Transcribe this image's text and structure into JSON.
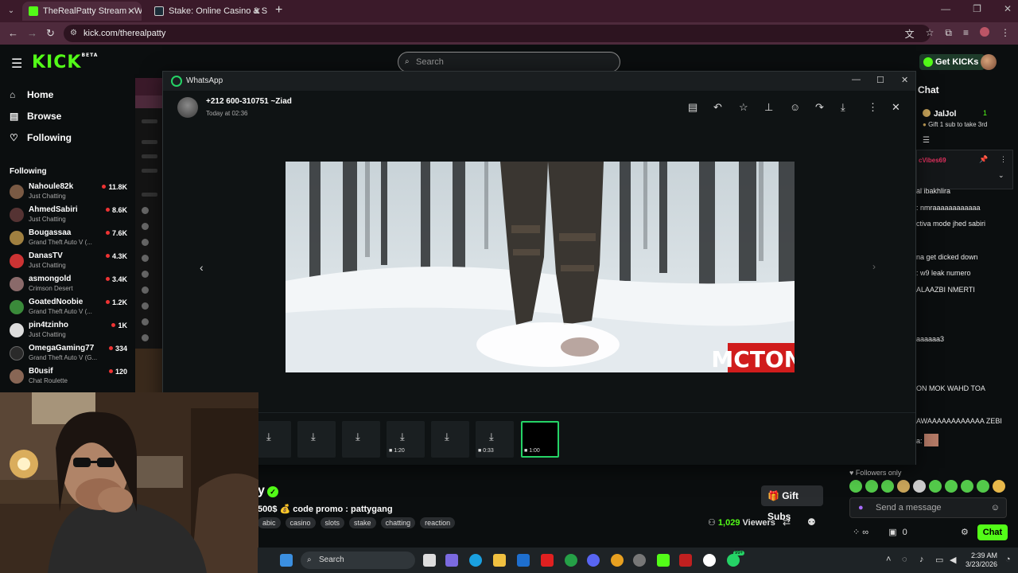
{
  "browser": {
    "tabs": [
      {
        "title": "TheRealPatty Stream - Watch Li",
        "favicon_color": "#53fc18"
      },
      {
        "title": "Stake: Online Casino & Sports B",
        "favicon_color": "#1a2c38"
      }
    ],
    "url": "kick.com/therealpatty"
  },
  "kick": {
    "logo": "KICK",
    "logo_badge": "BETA",
    "search_placeholder": "Search",
    "get_kicks": "Get KICKs",
    "nav": [
      "Home",
      "Browse",
      "Following"
    ],
    "following_heading": "Following",
    "following": [
      {
        "name": "Nahoule82k",
        "category": "Just Chatting",
        "viewers": "11.8K"
      },
      {
        "name": "AhmedSabiri",
        "category": "Just Chatting",
        "viewers": "8.6K"
      },
      {
        "name": "Bougassaa",
        "category": "Grand Theft Auto V (...",
        "viewers": "7.6K"
      },
      {
        "name": "DanasTV",
        "category": "Just Chatting",
        "viewers": "4.3K"
      },
      {
        "name": "asmongold",
        "category": "Crimson Desert",
        "viewers": "3.4K"
      },
      {
        "name": "GoatedNoobie",
        "category": "Grand Theft Auto V (...",
        "viewers": "1.2K"
      },
      {
        "name": "pin4tzinho",
        "category": "Just Chatting",
        "viewers": "1K"
      },
      {
        "name": "OmegaGaming77",
        "category": "Grand Theft Auto V (G...",
        "viewers": "334"
      },
      {
        "name": "B0usif",
        "category": "Chat Roulette",
        "viewers": "120"
      }
    ],
    "stream": {
      "title_fragment": "y",
      "promo": "500$ 💰 code promo : pattygang",
      "tags": [
        "abic",
        "casino",
        "slots",
        "stake",
        "chatting",
        "reaction"
      ],
      "gift_subs": "Gift Subs",
      "viewers_count": "1,029",
      "viewers_label": "Viewers"
    },
    "chat": {
      "title": "Chat",
      "pinned_user": "JalJol",
      "pinned_count": "1",
      "pinned_sub": "Gift 1 sub to take 3rd",
      "pinned_msg_user": "cVibes69",
      "messages": [
        "al ibakhlira",
        ": nmraaaaaaaaaaaa",
        "ctiva mode jhed sabiri",
        "na get dicked down",
        ": w9 leak numero",
        "ALAAZBI NMERTI",
        "aaaaaa3",
        "ON MOK WAHD TOA",
        "AWAAAAAAAAAAAA ZEBI",
        "a:"
      ],
      "followers_only": "Followers only",
      "input_placeholder": "Send a message",
      "infinity": "∞",
      "zero": "0",
      "send_label": "Chat"
    }
  },
  "whatsapp": {
    "app_title": "WhatsApp",
    "contact": "+212 600-310751 ~Ziad",
    "time": "Today at 02:36",
    "watermark": "MCTONI",
    "thumbnails": [
      {
        "duration": ""
      },
      {
        "duration": ""
      },
      {
        "duration": ""
      },
      {
        "duration": "1:20"
      },
      {
        "duration": ""
      },
      {
        "duration": "0:33"
      },
      {
        "duration": "1:00"
      }
    ]
  },
  "taskbar": {
    "search": "Search",
    "time": "2:39 AM",
    "date": "3/23/2026",
    "badge": "99+"
  },
  "colors": {
    "kick_green": "#53fc18",
    "whatsapp_green": "#25d366",
    "browser_tab": "#3b1a2a"
  }
}
